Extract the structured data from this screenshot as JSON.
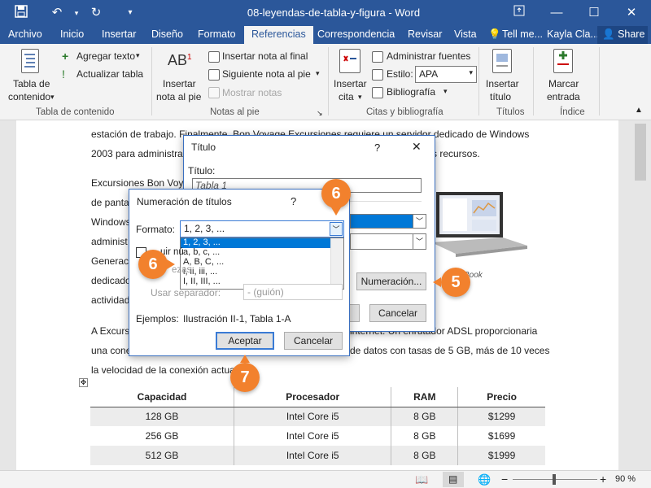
{
  "window": {
    "title": "08-leyendas-de-tabla-y-figura  -  Word",
    "icons": [
      "save-icon",
      "undo-icon",
      "redo-icon",
      "ribbon-display-icon",
      "minimize-icon",
      "maximize-icon",
      "close-icon"
    ]
  },
  "tabs": [
    {
      "label": "Archivo"
    },
    {
      "label": "Inicio"
    },
    {
      "label": "Insertar"
    },
    {
      "label": "Diseño"
    },
    {
      "label": "Formato"
    },
    {
      "label": "Referencias"
    },
    {
      "label": "Correspondencia"
    },
    {
      "label": "Revisar"
    },
    {
      "label": "Vista"
    },
    {
      "label": "Tell me..."
    }
  ],
  "user": "Kayla Cla...",
  "share_label": "Share",
  "ribbon": {
    "tabla_contenido": {
      "big_button": [
        "Tabla de",
        "contenido"
      ],
      "agregar_texto": "Agregar texto",
      "actualizar_tabla": "Actualizar tabla",
      "group": "Tabla de contenido"
    },
    "notas": {
      "big_button": [
        "Insertar",
        "nota al pie"
      ],
      "insertar_nota_final": "Insertar nota al final",
      "siguiente_nota": "Siguiente nota al pie",
      "mostrar_notas": "Mostrar notas",
      "group": "Notas al pie"
    },
    "citas": {
      "big_button": [
        "Insertar",
        "cita"
      ],
      "administrar_fuentes": "Administrar fuentes",
      "estilo_label": "Estilo:",
      "estilo_value": "APA",
      "bibliografia": "Bibliografía",
      "group": "Citas y bibliografía"
    },
    "titulos": {
      "big_button": [
        "Insertar",
        "título"
      ],
      "group": "Títulos"
    },
    "indice": {
      "big_button": [
        "Marcar",
        "entrada"
      ],
      "group": "Índice"
    }
  },
  "document": {
    "lines": [
      "estación de trabajo. Finalmente, Bon Voyage Excursiones requiere un servidor dedicado de Windows",
      "2003 para administrar",
      "s recursos.",
      "Excursiones Bon Voy",
      "de pantal",
      "Windows",
      "administ",
      "Generaci",
      "dedicado",
      "actividad",
      "A Excursi",
      "internet. Un enrutador ADSL proporcionaria",
      "una cone",
      "de datos con tasas de 5 GB, más de 10 veces",
      "la velocidad de la conexión actua"
    ],
    "image_caption": "Book",
    "table": {
      "headers": [
        "Capacidad",
        "Procesador",
        "RAM",
        "Precio"
      ],
      "rows": [
        [
          "128 GB",
          "Intel Core i5",
          "8 GB",
          "$1299"
        ],
        [
          "256 GB",
          "Intel Core i5",
          "8 GB",
          "$1699"
        ],
        [
          "512 GB",
          "Intel Core i5",
          "8 GB",
          "$1999"
        ]
      ]
    }
  },
  "dialog_titulo": {
    "title": "Título",
    "help": "?",
    "close": "✕",
    "caption_label": "Título:",
    "caption_value": "Tabla 1",
    "numbering_button": "Numeración...",
    "cancel_button": "Cancelar"
  },
  "dialog_numeracion": {
    "title": "Numeración de títulos",
    "help": "?",
    "format_label": "Formato:",
    "format_value": "1, 2, 3, ...",
    "options": [
      "1, 2, 3, ...",
      "a, b, c, ...",
      "A, B, C, ...",
      "i, ii, iii, ...",
      "I, II, III, ..."
    ],
    "include_chapter_partial": "uir nú",
    "style_partial": "ezas",
    "separator_label": "Usar separador:",
    "separator_value": "- (guión)",
    "examples_label": "Ejemplos:",
    "examples_value": "Ilustración II-1, Tabla 1-A",
    "ok_button": "Aceptar",
    "cancel_button": "Cancelar"
  },
  "callouts": [
    "5",
    "6",
    "6",
    "7"
  ],
  "status": {
    "zoom": "90 %",
    "minus": "−",
    "plus": "+"
  }
}
